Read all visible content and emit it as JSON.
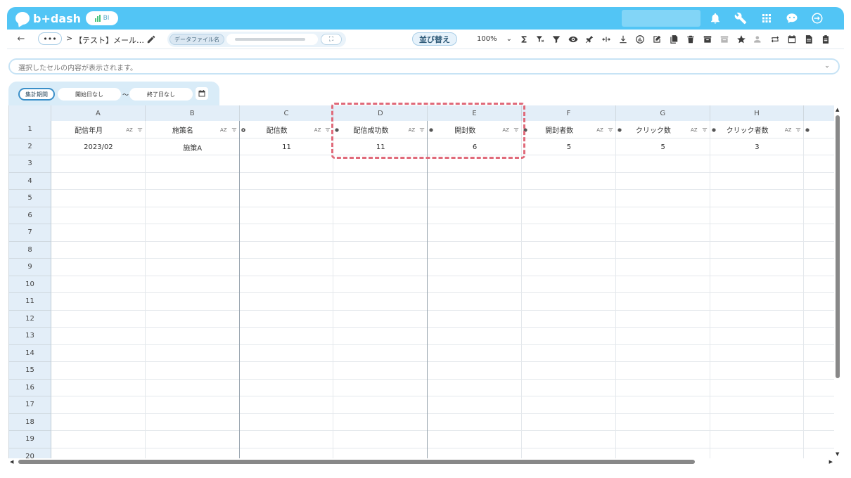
{
  "header": {
    "logo_text": "b+dash",
    "bi_badge": "BI",
    "icons": [
      "bell-icon",
      "wrench-icon",
      "grid-icon",
      "chat-bot-icon",
      "logout-icon"
    ]
  },
  "toolbar": {
    "back": "←",
    "more": "•••",
    "separator": ">",
    "breadcrumb_title": "【テスト】メール…",
    "file_label": "データファイル名",
    "expand": "⛶",
    "sort_button": "並び替え",
    "zoom": "100%"
  },
  "formula_bar": {
    "placeholder": "選択したセルの内容が表示されます。"
  },
  "date_filter": {
    "period_label": "集計期間",
    "start": "開始日なし",
    "tilde": "～",
    "end": "終了日なし"
  },
  "sheet": {
    "column_letters": [
      "A",
      "B",
      "C",
      "D",
      "E",
      "F",
      "G",
      "H"
    ],
    "row_numbers": [
      "1",
      "2",
      "3",
      "4",
      "5",
      "6",
      "7",
      "8",
      "9",
      "10",
      "11",
      "12",
      "13",
      "14",
      "15",
      "16",
      "17",
      "18",
      "19",
      "20"
    ],
    "headers": [
      "配信年月",
      "施策名",
      "配信数",
      "配信成功数",
      "開封数",
      "開封者数",
      "クリック数",
      "クリック者数"
    ],
    "sort_label": "AZ",
    "row2": [
      "2023/02",
      "施策A",
      "11",
      "11",
      "6",
      "5",
      "5",
      "3"
    ]
  },
  "colors": {
    "header_bg": "#52c5f5",
    "highlight": "#e06a7a"
  }
}
